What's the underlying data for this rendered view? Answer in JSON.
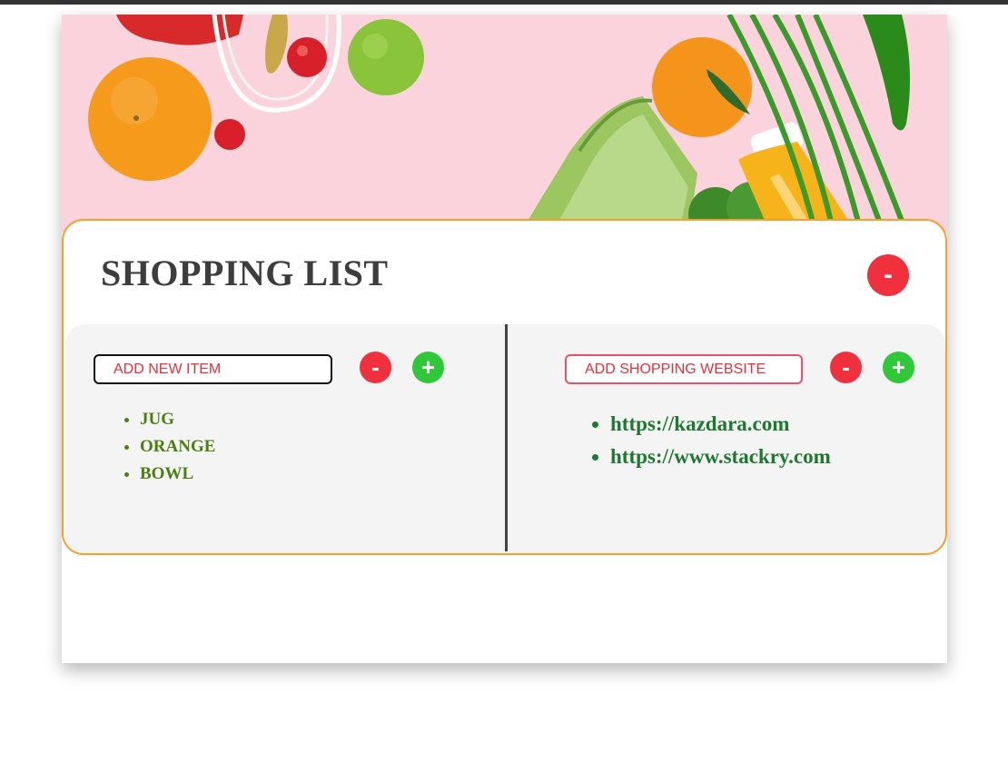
{
  "header": {
    "title": "SHOPPING LIST",
    "collapse_label": "-"
  },
  "items_section": {
    "input_placeholder": "ADD NEW ITEM",
    "remove_label": "-",
    "add_label": "+",
    "items": [
      "JUG",
      "ORANGE",
      "BOWL"
    ]
  },
  "sites_section": {
    "input_placeholder": "ADD SHOPPING WEBSITE",
    "remove_label": "-",
    "add_label": "+",
    "sites": [
      "https://kazdara.com",
      "https://www.stackry.com"
    ]
  },
  "colors": {
    "accent_border": "#f2a12a",
    "remove_button": "#f0303c",
    "add_button": "#2ec838",
    "item_text": "#4a8010",
    "site_text": "#1e7830",
    "hero_background": "#fbd3dc"
  },
  "icons": {
    "hero_image": "groceries-photo"
  }
}
